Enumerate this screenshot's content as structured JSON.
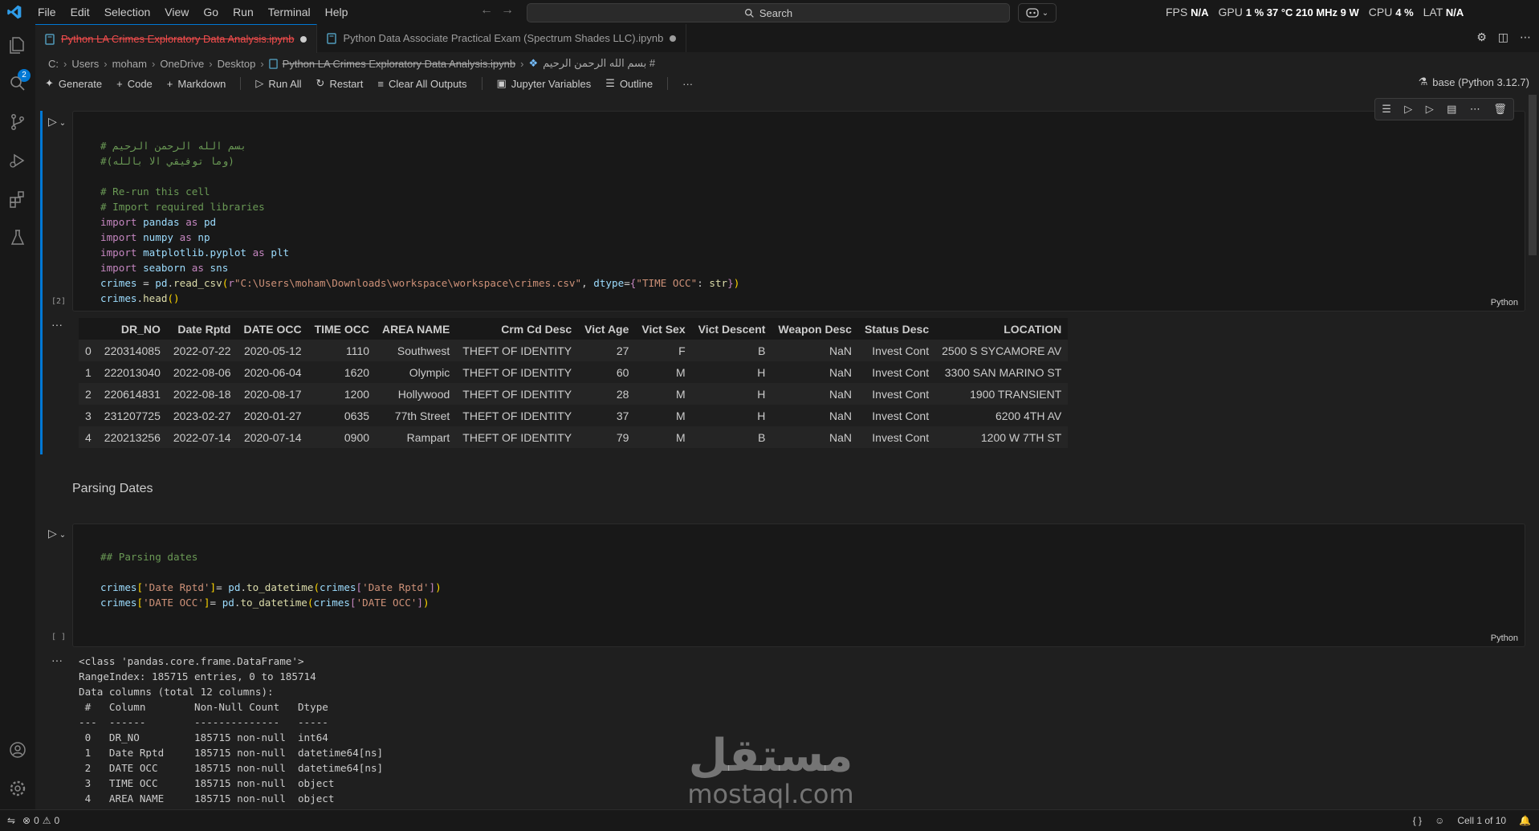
{
  "menu": [
    "File",
    "Edit",
    "Selection",
    "View",
    "Go",
    "Run",
    "Terminal",
    "Help"
  ],
  "search": {
    "label": "Search"
  },
  "stats": [
    {
      "label": "FPS",
      "value": "N/A"
    },
    {
      "label": "GPU",
      "value": "1 %  37 °C  210 MHz  9 W"
    },
    {
      "label": "CPU",
      "value": "4 %"
    },
    {
      "label": "LAT",
      "value": "N/A"
    }
  ],
  "activity_badge": "2",
  "tabs": [
    {
      "label": "Python LA Crimes Exploratory Data Analysis.ipynb",
      "active": true,
      "error": true
    },
    {
      "label": "Python Data Associate Practical Exam (Spectrum Shades LLC).ipynb",
      "active": false,
      "error": false
    }
  ],
  "breadcrumb": [
    "C:",
    "Users",
    "moham",
    "OneDrive",
    "Desktop",
    "Python LA Crimes Exploratory Data Analysis.ipynb",
    "بسم الله الرحمن الرحيم #"
  ],
  "toolbar": {
    "generate": "Generate",
    "code": "Code",
    "markdown": "Markdown",
    "run_all": "Run All",
    "restart": "Restart",
    "clear": "Clear All Outputs",
    "variables": "Jupyter Variables",
    "outline": "Outline",
    "more": "···"
  },
  "kernel": "base (Python 3.12.7)",
  "cell1": {
    "lines": [
      "# بسم الله الرحمن الرحيم",
      "#(وما توفيقي الا بالله)",
      "",
      "# Re-run this cell",
      "# Import required libraries",
      "import pandas as pd",
      "import numpy as np",
      "import matplotlib.pyplot as plt",
      "import seaborn as sns",
      "crimes = pd.read_csv(r\"C:\\Users\\moham\\Downloads\\workspace\\workspace\\crimes.csv\", dtype={\"TIME OCC\": str})",
      "crimes.head()"
    ],
    "exec_count": "[2]",
    "language": "Python"
  },
  "dataframe": {
    "columns": [
      "",
      "DR_NO",
      "Date Rptd",
      "DATE OCC",
      "TIME OCC",
      "AREA NAME",
      "Crm Cd Desc",
      "Vict Age",
      "Vict Sex",
      "Vict Descent",
      "Weapon Desc",
      "Status Desc",
      "LOCATION"
    ],
    "rows": [
      [
        "0",
        "220314085",
        "2022-07-22",
        "2020-05-12",
        "1110",
        "Southwest",
        "THEFT OF IDENTITY",
        "27",
        "F",
        "B",
        "NaN",
        "Invest Cont",
        "2500 S SYCAMORE AV"
      ],
      [
        "1",
        "222013040",
        "2022-08-06",
        "2020-06-04",
        "1620",
        "Olympic",
        "THEFT OF IDENTITY",
        "60",
        "M",
        "H",
        "NaN",
        "Invest Cont",
        "3300 SAN MARINO ST"
      ],
      [
        "2",
        "220614831",
        "2022-08-18",
        "2020-08-17",
        "1200",
        "Hollywood",
        "THEFT OF IDENTITY",
        "28",
        "M",
        "H",
        "NaN",
        "Invest Cont",
        "1900 TRANSIENT"
      ],
      [
        "3",
        "231207725",
        "2023-02-27",
        "2020-01-27",
        "0635",
        "77th Street",
        "THEFT OF IDENTITY",
        "37",
        "M",
        "H",
        "NaN",
        "Invest Cont",
        "6200 4TH AV"
      ],
      [
        "4",
        "220213256",
        "2022-07-14",
        "2020-07-14",
        "0900",
        "Rampart",
        "THEFT OF IDENTITY",
        "79",
        "M",
        "B",
        "NaN",
        "Invest Cont",
        "1200 W 7TH ST"
      ]
    ]
  },
  "markdown_heading": "Parsing Dates",
  "cell2": {
    "lines": [
      "## Parsing dates",
      "",
      "crimes['Date Rptd']= pd.to_datetime(crimes['Date Rptd'])",
      "crimes['DATE OCC']= pd.to_datetime(crimes['DATE OCC'])"
    ],
    "exec_count": "[ ]",
    "language": "Python"
  },
  "info_output": [
    "<class 'pandas.core.frame.DataFrame'>",
    "RangeIndex: 185715 entries, 0 to 185714",
    "Data columns (total 12 columns):",
    " #   Column        Non-Null Count   Dtype",
    "---  ------        --------------   -----",
    " 0   DR_NO         185715 non-null  int64",
    " 1   Date Rptd     185715 non-null  datetime64[ns]",
    " 2   DATE OCC      185715 non-null  datetime64[ns]",
    " 3   TIME OCC      185715 non-null  object",
    " 4   AREA NAME     185715 non-null  object"
  ],
  "output_ellipsis": "···",
  "watermark": {
    "arabic": "مستقل",
    "latin": "mostaql.com"
  },
  "statusbar": {
    "errors": "0",
    "warnings": "0",
    "cell": "Cell 1 of 10",
    "braces": "{ }"
  },
  "colors": {
    "accent": "#0078d4",
    "error": "#f14c4c",
    "keyword": "#c586c0",
    "comment": "#6a9955",
    "string": "#ce9178",
    "function": "#dcdcaa",
    "variable": "#9cdcfe"
  }
}
